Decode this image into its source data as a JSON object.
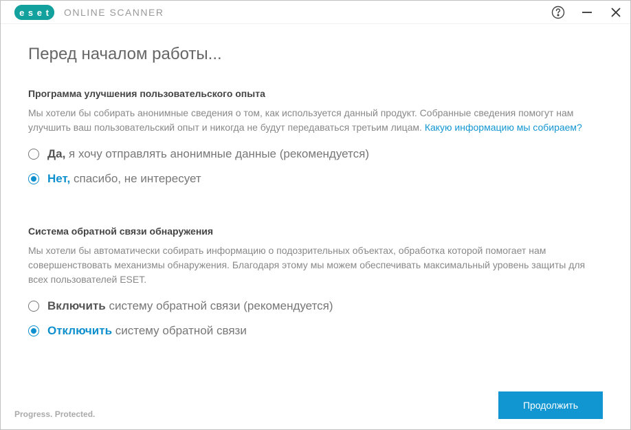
{
  "titlebar": {
    "product_name": "ONLINE SCANNER"
  },
  "page_title": "Перед началом работы...",
  "section1": {
    "title": "Программа улучшения пользовательского опыта",
    "desc_text": "Мы хотели бы собирать анонимные сведения о том, как используется данный продукт. Собранные сведения помогут нам улучшить ваш пользовательский опыт и никогда не будут передаваться третьим лицам. ",
    "link_text": "Какую информацию мы собираем?",
    "option1_bold": "Да,",
    "option1_rest": " я хочу отправлять анонимные данные (рекомендуется)",
    "option2_bold": "Нет,",
    "option2_rest": " спасибо, не интересует",
    "selected": 1
  },
  "section2": {
    "title": "Система обратной связи обнаружения",
    "desc_text": "Мы хотели бы автоматически собирать информацию о подозрительных объектах, обработка которой помогает нам совершенствовать механизмы обнаружения. Благодаря этому мы можем обеспечивать максимальный уровень защиты для всех пользователей ESET.",
    "option1_bold": "Включить",
    "option1_rest": " систему обратной связи (рекомендуется)",
    "option2_bold": "Отключить",
    "option2_rest": " систему обратной связи",
    "selected": 1
  },
  "footer": {
    "tagline": "Progress. Protected.",
    "continue_label": "Продолжить"
  }
}
